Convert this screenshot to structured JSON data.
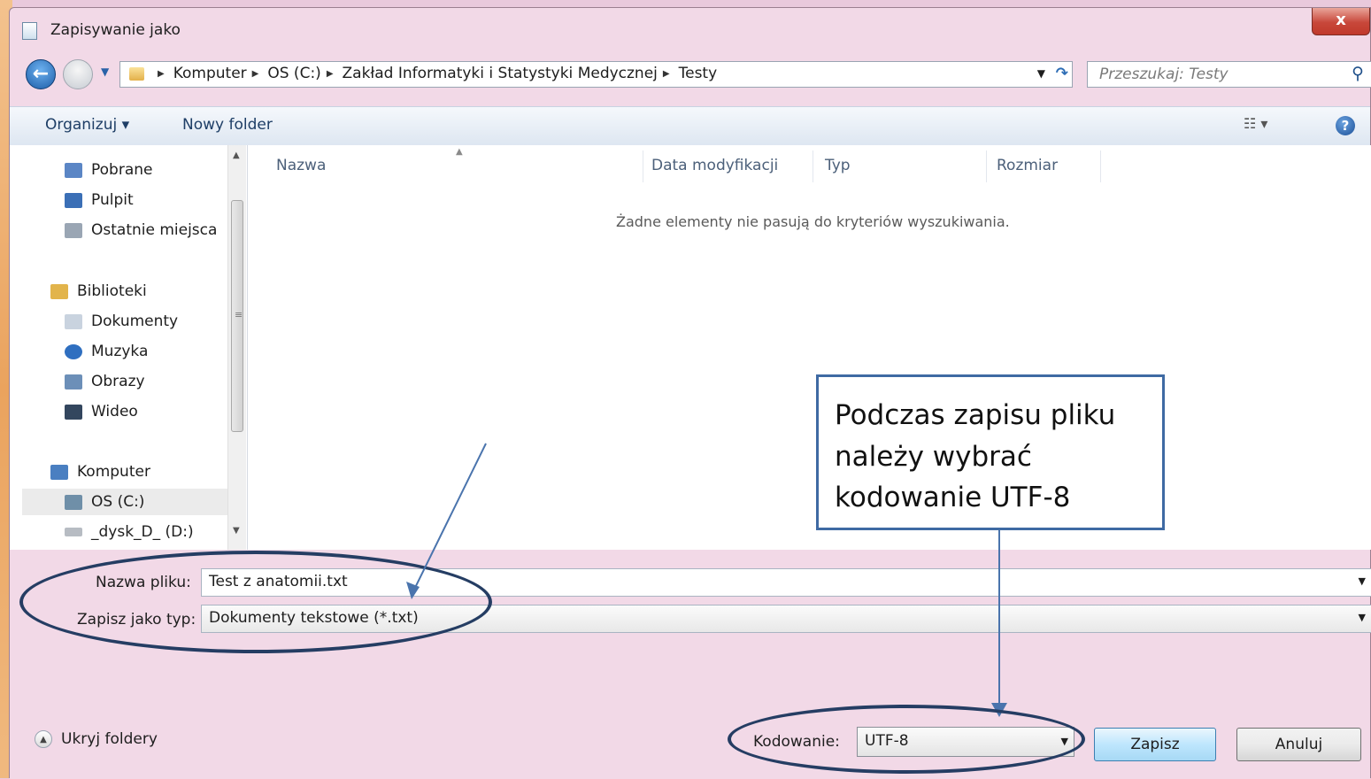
{
  "window": {
    "title": "Zapisywanie jako",
    "close": "x"
  },
  "nav": {
    "back_icon": "back-arrow-icon",
    "breadcrumb": [
      "Komputer",
      "OS (C:)",
      "Zakład Informatyki i Statystyki Medycznej",
      "Testy"
    ],
    "search_placeholder": "Przeszukaj: Testy"
  },
  "toolbar": {
    "organize": "Organizuj ▾",
    "new_folder": "Nowy folder",
    "view": "☷ ▾",
    "help": "?"
  },
  "sidebar": {
    "items": [
      {
        "label": "Pobrane",
        "icon": "downloads-icon",
        "color": "#5b86c5"
      },
      {
        "label": "Pulpit",
        "icon": "desktop-icon",
        "color": "#3b6fb6"
      },
      {
        "label": "Ostatnie miejsca",
        "icon": "recent-places-icon",
        "color": "#9aa6b4"
      },
      {
        "label": "Biblioteki",
        "icon": "libraries-icon",
        "color": "#e2b44b"
      },
      {
        "label": "Dokumenty",
        "icon": "documents-icon",
        "color": "#c9d3df"
      },
      {
        "label": "Muzyka",
        "icon": "music-icon",
        "color": "#2f6fc0"
      },
      {
        "label": "Obrazy",
        "icon": "pictures-icon",
        "color": "#6c8fb8"
      },
      {
        "label": "Wideo",
        "icon": "video-icon",
        "color": "#33465e"
      },
      {
        "label": "Komputer",
        "icon": "computer-icon",
        "color": "#4a7fc1"
      },
      {
        "label": "OS (C:)",
        "icon": "drive-c-icon",
        "color": "#6f8fa8"
      },
      {
        "label": "_dysk_D_ (D:)",
        "icon": "drive-d-icon",
        "color": "#b7bcc3"
      }
    ]
  },
  "filelist": {
    "columns": [
      "Nazwa",
      "Data modyfikacji",
      "Typ",
      "Rozmiar"
    ],
    "empty_message": "Żadne elementy nie pasują do kryteriów wyszukiwania."
  },
  "form": {
    "filename_label": "Nazwa pliku:",
    "filename_value": "Test z anatomii.txt",
    "type_label": "Zapisz jako typ:",
    "type_value": "Dokumenty tekstowe (*.txt)",
    "hide_folders": "Ukryj foldery",
    "encoding_label": "Kodowanie:",
    "encoding_value": "UTF-8",
    "save": "Zapisz",
    "cancel": "Anuluj"
  },
  "annotation": {
    "callout_text": "Podczas zapisu pliku należy wybrać kodowanie UTF-8",
    "accent_color": "#3f6aa3"
  }
}
